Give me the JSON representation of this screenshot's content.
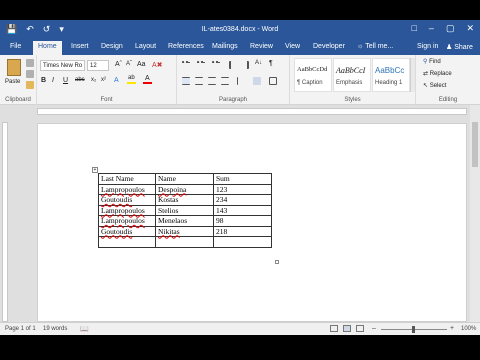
{
  "window": {
    "title": "IL-ates0384.docx - Word",
    "qat_icons": [
      "save-icon",
      "undo-icon",
      "redo-icon",
      "customize-qat-icon"
    ]
  },
  "tabs": [
    {
      "label": "File"
    },
    {
      "label": "Home"
    },
    {
      "label": "Insert"
    },
    {
      "label": "Design"
    },
    {
      "label": "Layout"
    },
    {
      "label": "References"
    },
    {
      "label": "Mailings"
    },
    {
      "label": "Review"
    },
    {
      "label": "View"
    },
    {
      "label": "Developer"
    }
  ],
  "tell_me": "Tell me...",
  "account": {
    "sign_in": "Sign in",
    "share": "Share"
  },
  "ribbon": {
    "clipboard": {
      "paste": "Paste",
      "label": "Clipboard"
    },
    "font": {
      "name": "Times New Ro",
      "size": "12",
      "label": "Font",
      "bold": "B",
      "italic": "I",
      "underline": "U"
    },
    "paragraph": {
      "label": "Paragraph"
    },
    "styles": {
      "label": "Styles",
      "items": [
        {
          "sample": "AaBbCcDd",
          "name": "¶ Caption"
        },
        {
          "sample": "AaBbCcI",
          "name": "Emphasis"
        },
        {
          "sample": "AaBbCc",
          "name": "Heading 1"
        }
      ]
    },
    "editing": {
      "find": "Find",
      "replace": "Replace",
      "select": "Select",
      "label": "Editing"
    }
  },
  "document": {
    "table": {
      "rows": [
        [
          "Last Name",
          "Name",
          "Sum"
        ],
        [
          "Lampropoulos",
          "Despoina",
          "123"
        ],
        [
          "Goutoudis",
          "Kostas",
          "234"
        ],
        [
          "Lampropoulos",
          "Stelios",
          "143"
        ],
        [
          "Lampropoulos",
          "Menelaos",
          "98"
        ],
        [
          "Goutoudis",
          "Nikitas",
          "218"
        ],
        [
          "",
          "",
          ""
        ]
      ]
    }
  },
  "status": {
    "page": "Page 1 of 1",
    "words": "19 words",
    "zoom": "100%"
  }
}
